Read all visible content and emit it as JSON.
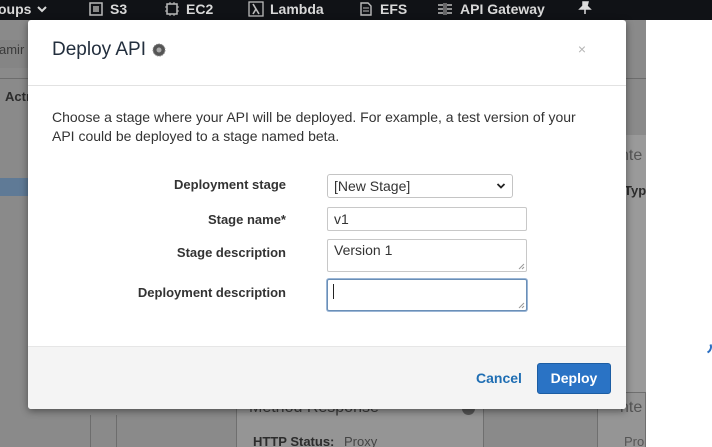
{
  "topnav": {
    "items": [
      {
        "label": "oups",
        "icon": "chevron-down-icon"
      },
      {
        "label": "S3",
        "icon": "s3-icon"
      },
      {
        "label": "EC2",
        "icon": "ec2-icon"
      },
      {
        "label": "Lambda",
        "icon": "lambda-icon"
      },
      {
        "label": "EFS",
        "icon": "efs-icon"
      },
      {
        "label": "API Gateway",
        "icon": "api-gateway-icon"
      }
    ],
    "pin_icon": "pin-icon"
  },
  "background": {
    "left_tab": "amir",
    "actions": "Actı",
    "right_tab_1": "nte",
    "right_tab_2": "Typ",
    "method_response": "Method Response",
    "http_status_label": "HTTP Status:",
    "http_status_value": "Proxy",
    "right_tab_3": "nte",
    "right_tab_4": "Pro"
  },
  "modal": {
    "title": "Deploy API",
    "close": "×",
    "description": "Choose a stage where your API will be deployed. For example, a test version of your API could be deployed to a stage named beta.",
    "fields": {
      "deployment_stage": {
        "label": "Deployment stage",
        "value": "[New Stage]"
      },
      "stage_name": {
        "label": "Stage name*",
        "value": "v1"
      },
      "stage_description": {
        "label": "Stage description",
        "value": "Version 1"
      },
      "deployment_description": {
        "label": "Deployment description",
        "value": ""
      }
    },
    "footer": {
      "cancel": "Cancel",
      "deploy": "Deploy"
    }
  },
  "colors": {
    "primary": "#2a73c5",
    "link": "#1f6eb3",
    "nav_bg": "#101216"
  }
}
